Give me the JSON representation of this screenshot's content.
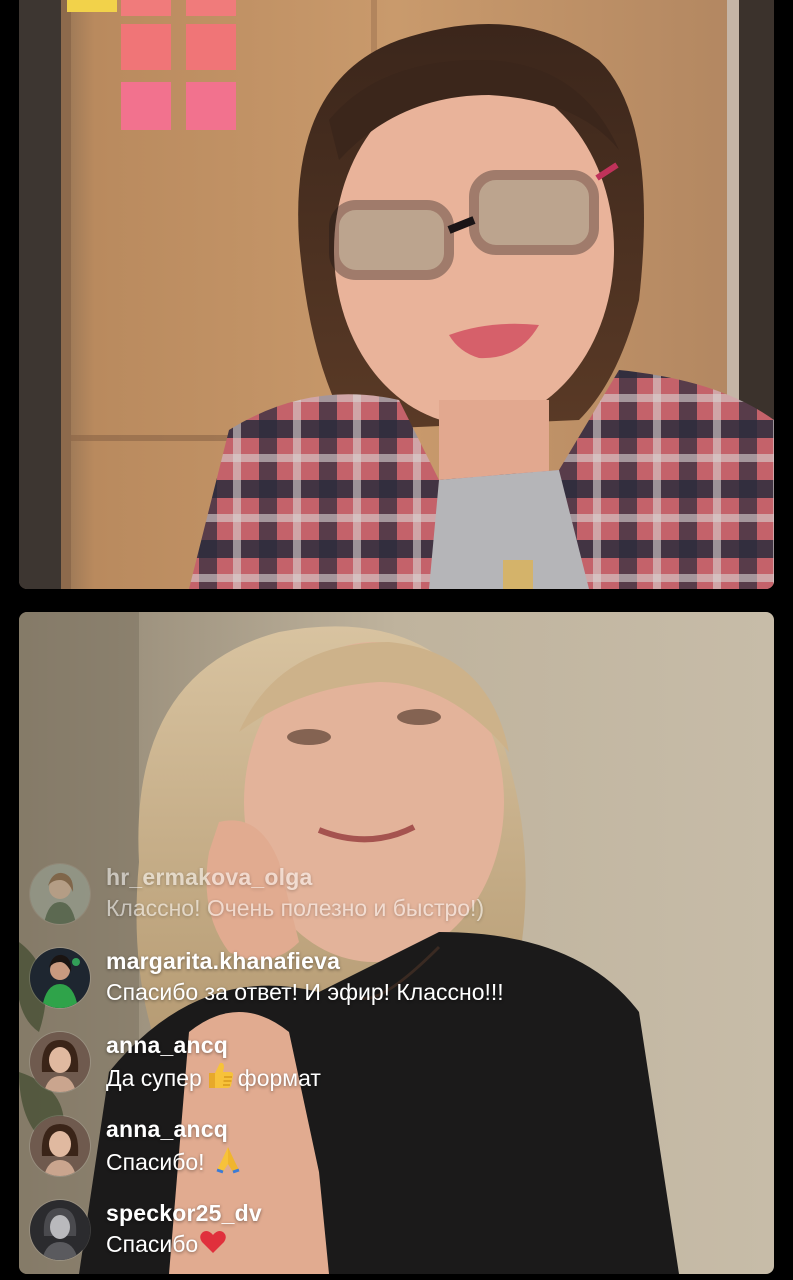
{
  "live_session": {
    "participants": [
      {
        "name": "host-video"
      },
      {
        "name": "guest-video"
      }
    ]
  },
  "comments": [
    {
      "username": "hr_ermakova_olga",
      "message": "Классно! Очень полезно и быстро!)",
      "faded": true,
      "avatar_icon": "profile-photo"
    },
    {
      "username": "margarita.khanafieva",
      "message": "Спасибо за ответ! И эфир! Классно!!!",
      "faded": false,
      "avatar_icon": "profile-photo"
    },
    {
      "username": "anna_ancq",
      "message_before": "Да супер",
      "message_after": "формат",
      "emoji": "thumbs-up",
      "faded": false,
      "avatar_icon": "profile-photo"
    },
    {
      "username": "anna_ancq",
      "message_before": "Спасибо!",
      "emoji": "folded-hands",
      "faded": false,
      "avatar_icon": "profile-photo"
    },
    {
      "username": "speckor25_dv",
      "message_before": "Спасибо",
      "emoji": "red-heart",
      "faded": false,
      "avatar_icon": "profile-photo"
    }
  ],
  "colors": {
    "background": "#000000",
    "text": "#ffffff",
    "heart": "#e0303c",
    "thumbs": "#f7c23a"
  }
}
